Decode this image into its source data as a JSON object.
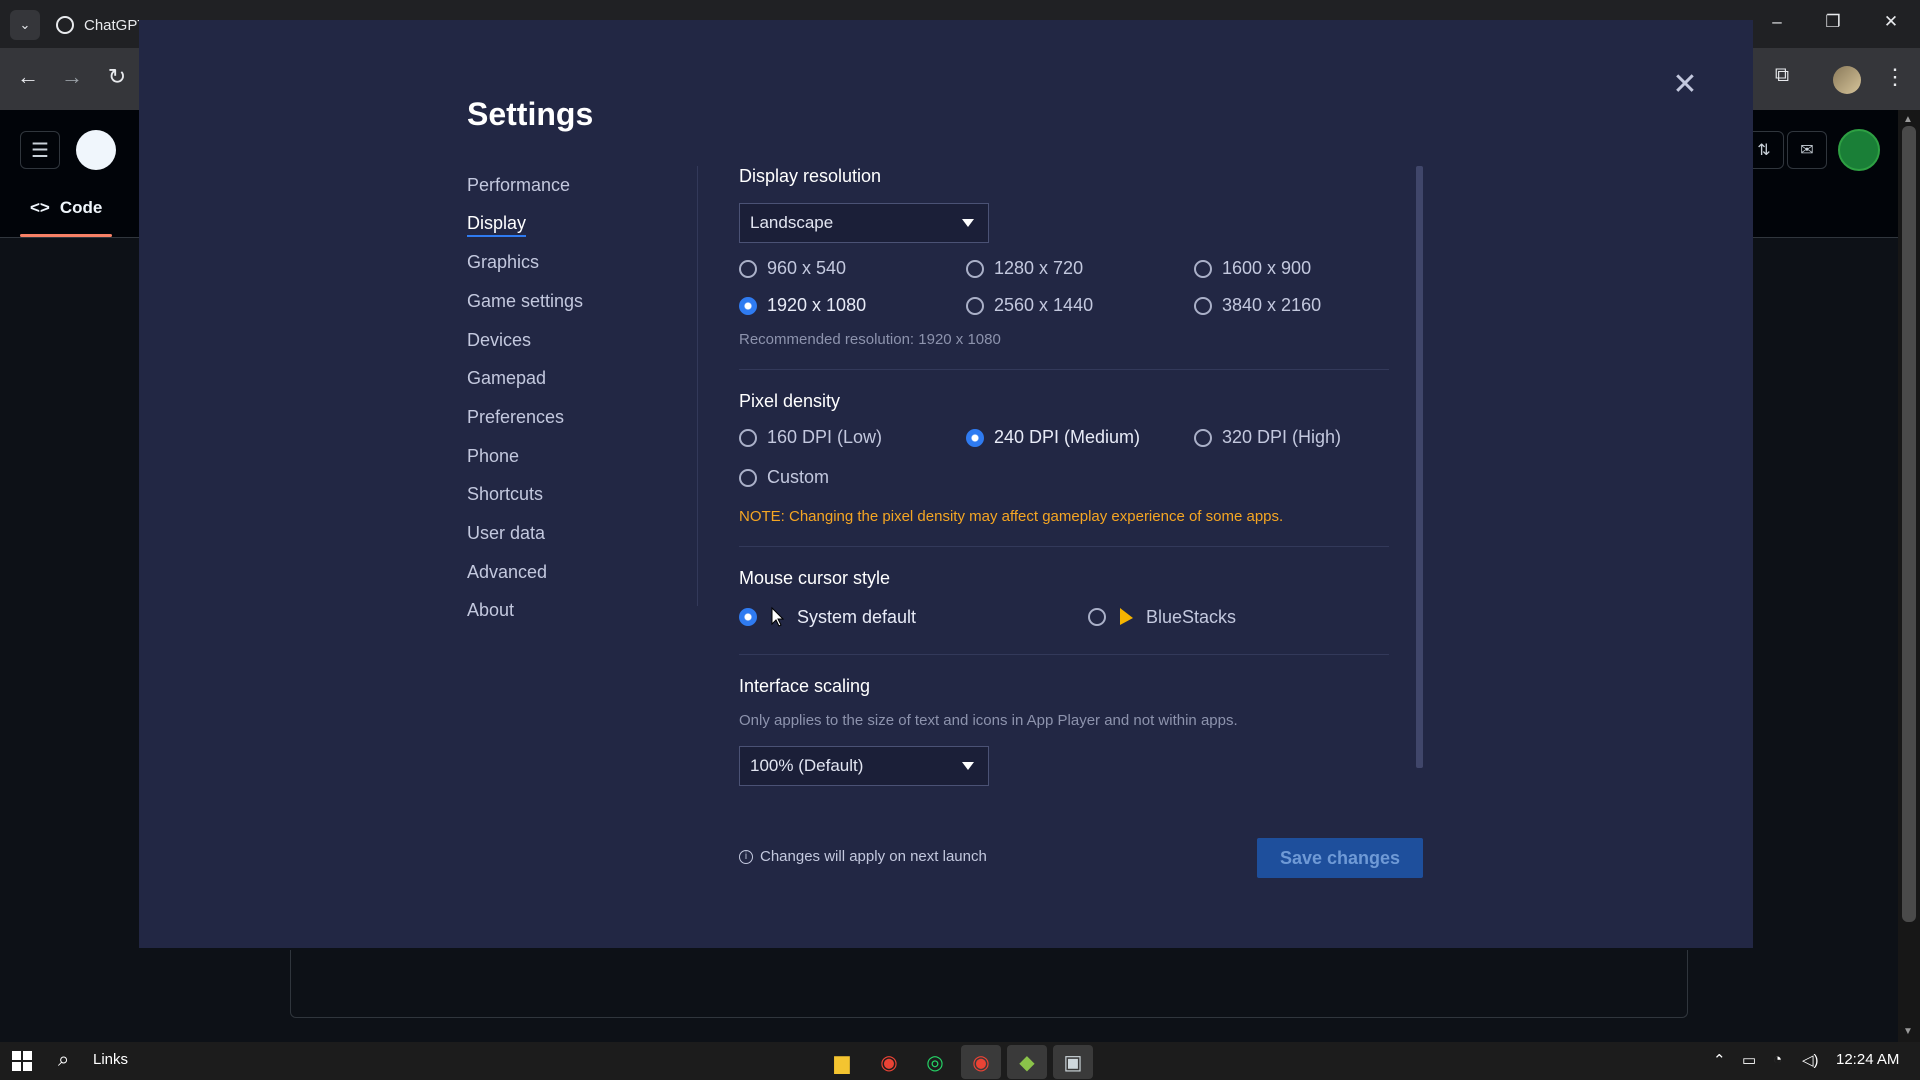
{
  "browser": {
    "tab_title": "ChatGPT",
    "window_controls": [
      "–",
      "❐",
      "✕"
    ]
  },
  "github": {
    "tab_code_label": "Code"
  },
  "settings": {
    "title": "Settings",
    "nav": [
      {
        "label": "Performance",
        "active": false
      },
      {
        "label": "Display",
        "active": true
      },
      {
        "label": "Graphics",
        "active": false
      },
      {
        "label": "Game settings",
        "active": false
      },
      {
        "label": "Devices",
        "active": false
      },
      {
        "label": "Gamepad",
        "active": false
      },
      {
        "label": "Preferences",
        "active": false
      },
      {
        "label": "Phone",
        "active": false
      },
      {
        "label": "Shortcuts",
        "active": false
      },
      {
        "label": "User data",
        "active": false
      },
      {
        "label": "Advanced",
        "active": false
      },
      {
        "label": "About",
        "active": false
      }
    ],
    "display_resolution": {
      "title": "Display resolution",
      "orientation_selected": "Landscape",
      "options": [
        "960 x 540",
        "1280 x 720",
        "1600 x 900",
        "1920 x 1080",
        "2560 x 1440",
        "3840 x 2160"
      ],
      "selected": "1920 x 1080",
      "recommended": "Recommended resolution: 1920 x 1080"
    },
    "pixel_density": {
      "title": "Pixel density",
      "options": [
        "160 DPI (Low)",
        "240 DPI (Medium)",
        "320 DPI (High)",
        "Custom"
      ],
      "selected": "240 DPI (Medium)",
      "note": "NOTE: Changing the pixel density may affect gameplay experience of some apps."
    },
    "mouse_cursor": {
      "title": "Mouse cursor style",
      "options": [
        "System default",
        "BlueStacks"
      ],
      "selected": "System default"
    },
    "interface_scaling": {
      "title": "Interface scaling",
      "description": "Only applies to the size of text and icons in App Player and not within apps.",
      "selected": "100% (Default)"
    },
    "footer_info": "Changes will apply on next launch",
    "save_label": "Save changes"
  },
  "taskbar": {
    "search_label": "Links",
    "time": "12:24 AM"
  },
  "colors": {
    "modal_bg": "#222744",
    "accent": "#2f7bf1",
    "note": "#f5a623",
    "save_btn": "#1e4f9c"
  }
}
